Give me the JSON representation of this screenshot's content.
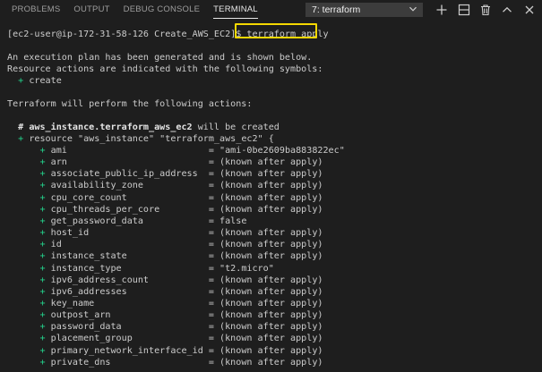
{
  "panel": {
    "tabs": [
      "PROBLEMS",
      "OUTPUT",
      "DEBUG CONSOLE",
      "TERMINAL"
    ],
    "active_tab": "TERMINAL",
    "terminal_select": "7: terraform"
  },
  "terminal": {
    "prompt": "[ec2-user@ip-172-31-58-126 Create_AWS_EC2]$ ",
    "command": "terraform apply",
    "intro": [
      "An execution plan has been generated and is shown below.",
      "Resource actions are indicated with the following symbols:"
    ],
    "symbol_line": "create",
    "perform": "Terraform will perform the following actions:",
    "resource_comment_prefix": "# ",
    "resource_name": "aws_instance.terraform_aws_ec2",
    "resource_comment_suffix": " will be created",
    "resource_decl": "resource \"aws_instance\" \"terraform_aws_ec2\" {",
    "attributes": [
      {
        "key": "ami",
        "value": "\"ami-0be2609ba883822ec\""
      },
      {
        "key": "arn",
        "value": "(known after apply)"
      },
      {
        "key": "associate_public_ip_address",
        "value": "(known after apply)"
      },
      {
        "key": "availability_zone",
        "value": "(known after apply)"
      },
      {
        "key": "cpu_core_count",
        "value": "(known after apply)"
      },
      {
        "key": "cpu_threads_per_core",
        "value": "(known after apply)"
      },
      {
        "key": "get_password_data",
        "value": "false"
      },
      {
        "key": "host_id",
        "value": "(known after apply)"
      },
      {
        "key": "id",
        "value": "(known after apply)"
      },
      {
        "key": "instance_state",
        "value": "(known after apply)"
      },
      {
        "key": "instance_type",
        "value": "\"t2.micro\""
      },
      {
        "key": "ipv6_address_count",
        "value": "(known after apply)"
      },
      {
        "key": "ipv6_addresses",
        "value": "(known after apply)"
      },
      {
        "key": "key_name",
        "value": "(known after apply)"
      },
      {
        "key": "outpost_arn",
        "value": "(known after apply)"
      },
      {
        "key": "password_data",
        "value": "(known after apply)"
      },
      {
        "key": "placement_group",
        "value": "(known after apply)"
      },
      {
        "key": "primary_network_interface_id",
        "value": "(known after apply)"
      },
      {
        "key": "private_dns",
        "value": "(known after apply)"
      }
    ]
  },
  "colors": {
    "background": "#1e1e1e",
    "text": "#cccccc",
    "green": "#23d18b",
    "highlight_border": "#f5d800"
  },
  "icons": [
    "chevron-down-icon",
    "plus-icon",
    "split-icon",
    "trash-icon",
    "chevron-up-icon",
    "close-icon"
  ]
}
